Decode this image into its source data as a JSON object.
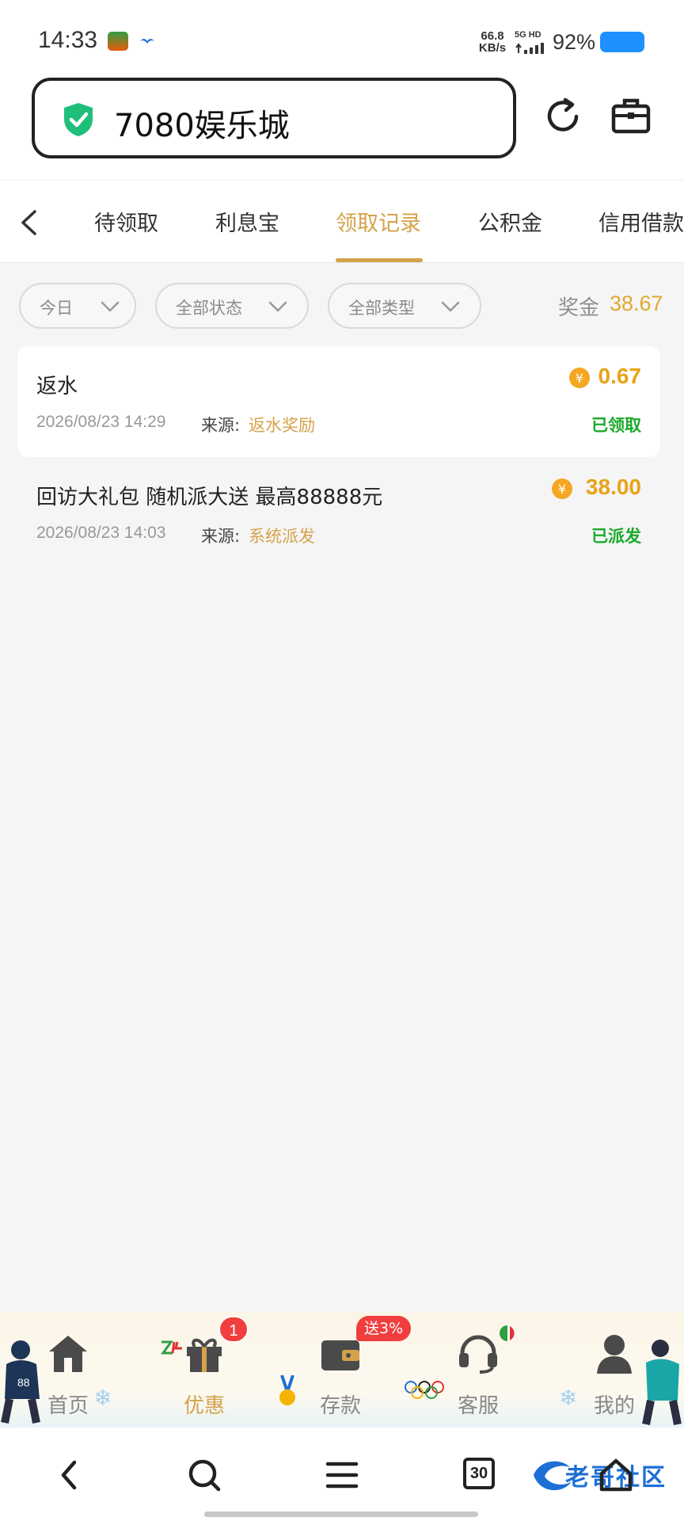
{
  "status_bar": {
    "time": "14:33",
    "net_speed_value": "66.8",
    "net_speed_unit": "KB/s",
    "network": "5G HD",
    "battery": "92%"
  },
  "address_bar": {
    "title": "7080娱乐城",
    "shield_color": "#1fbf7a"
  },
  "tabs": [
    {
      "label": "待领取"
    },
    {
      "label": "利息宝"
    },
    {
      "label": "领取记录",
      "active": true
    },
    {
      "label": "公积金"
    },
    {
      "label": "信用借款"
    }
  ],
  "filters": [
    {
      "label": "今日"
    },
    {
      "label": "全部状态"
    },
    {
      "label": "全部类型"
    }
  ],
  "bonus": {
    "label": "奖金",
    "value": "38.67"
  },
  "records": [
    {
      "title": "返水",
      "datetime": "2026/08/23 14:29",
      "source_label": "来源:",
      "source": "返水奖励",
      "amount": "0.67",
      "status": "已领取"
    },
    {
      "title": "回访大礼包 随机派大送 最高88888元",
      "datetime": "2026/08/23 14:03",
      "source_label": "来源:",
      "source": "系统派发",
      "amount": "38.00",
      "status": "已派发"
    }
  ],
  "app_nav": {
    "items": [
      {
        "label": "首页",
        "icon": "home-icon"
      },
      {
        "label": "优惠",
        "icon": "gift-icon",
        "active": true
      },
      {
        "label": "存款",
        "icon": "wallet-icon"
      },
      {
        "label": "客服",
        "icon": "headset-icon"
      },
      {
        "label": "我的",
        "icon": "user-icon"
      }
    ],
    "promo_badge_count": "1",
    "deposit_badge": "送3%"
  },
  "system_nav": {
    "tab_count": "30",
    "watermark": "老哥社区"
  },
  "colors": {
    "accent": "#d4a24a",
    "amount": "#e8a317",
    "status_green": "#1aaa2b",
    "badge_red": "#f03e3e"
  }
}
